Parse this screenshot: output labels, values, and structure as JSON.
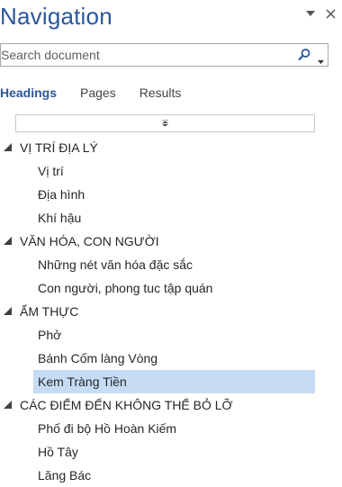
{
  "pane": {
    "title": "Navigation"
  },
  "search": {
    "placeholder": "Search document"
  },
  "tabs": [
    {
      "label": "Headings"
    },
    {
      "label": "Pages"
    },
    {
      "label": "Results"
    }
  ],
  "headings": [
    {
      "label": "VỊ TRÍ ĐỊA LÝ",
      "children": [
        "Vị trí",
        "Địa hình",
        "Khí hậu"
      ]
    },
    {
      "label": "VĂN HÓA, CON NGƯỜI",
      "children": [
        "Những nét văn hóa đặc sắc",
        "Con người, phong tuc tập quán"
      ]
    },
    {
      "label": "ẨM THỰC",
      "children": [
        "Phở",
        "Bánh Cốm làng Vòng",
        "Kem Tràng Tiền"
      ]
    },
    {
      "label": "CÁC ĐIỂM ĐẾN KHÔNG THỂ BỎ LỠ",
      "children": [
        "Phố đi bộ Hồ Hoàn Kiếm",
        "Hồ Tây",
        "Lăng Bác"
      ]
    }
  ],
  "selected": "Kem Tràng Tiền",
  "colors": {
    "accent": "#2b579a",
    "selection": "#c6dcf5"
  }
}
